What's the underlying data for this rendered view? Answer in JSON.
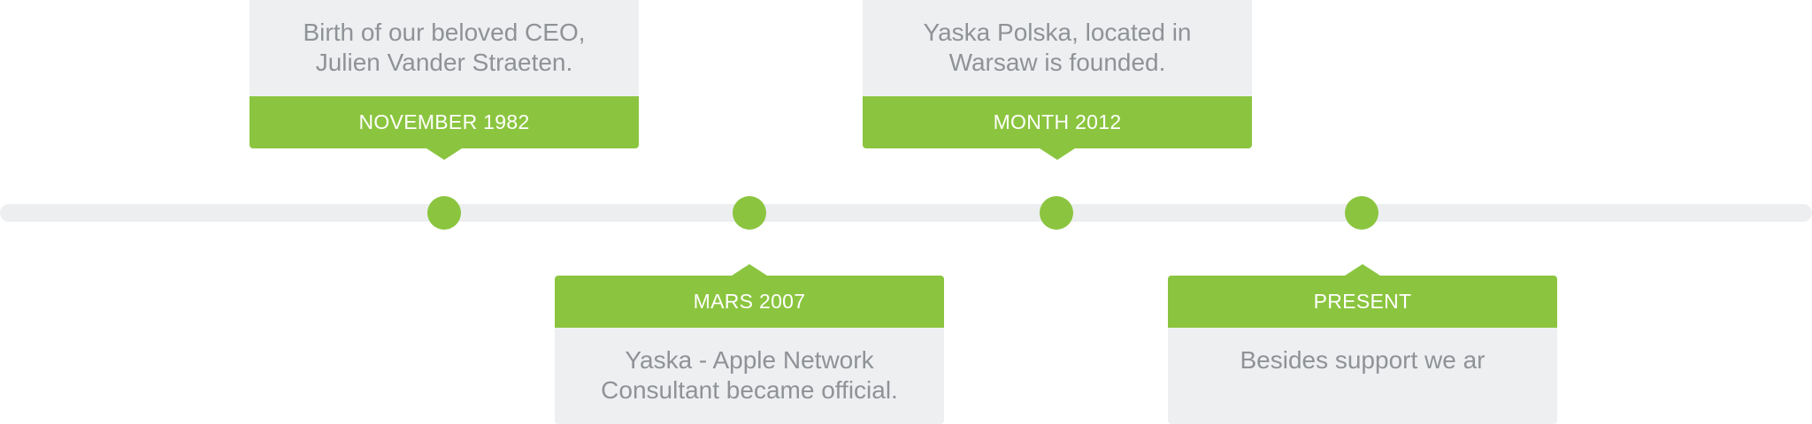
{
  "timeline": {
    "events": [
      {
        "date": "NOVEMBER 1982",
        "description_lines": [
          "Birth of our beloved CEO,",
          "Julien Vander Straeten."
        ]
      },
      {
        "date": "MARS 2007",
        "description_lines": [
          "Yaska - Apple Network",
          "Consultant became official."
        ]
      },
      {
        "date": "MONTH 2012",
        "description_lines": [
          "Yaska Polska, located in",
          "Warsaw is founded."
        ]
      },
      {
        "date": "PRESENT",
        "description_lines": [
          "Besides support we ar"
        ]
      }
    ]
  },
  "colors": {
    "accent": "#8bc53f",
    "track": "#edeef0",
    "card_background": "#eeeff1",
    "card_text": "#8f9296",
    "date_text": "#ffffff"
  }
}
